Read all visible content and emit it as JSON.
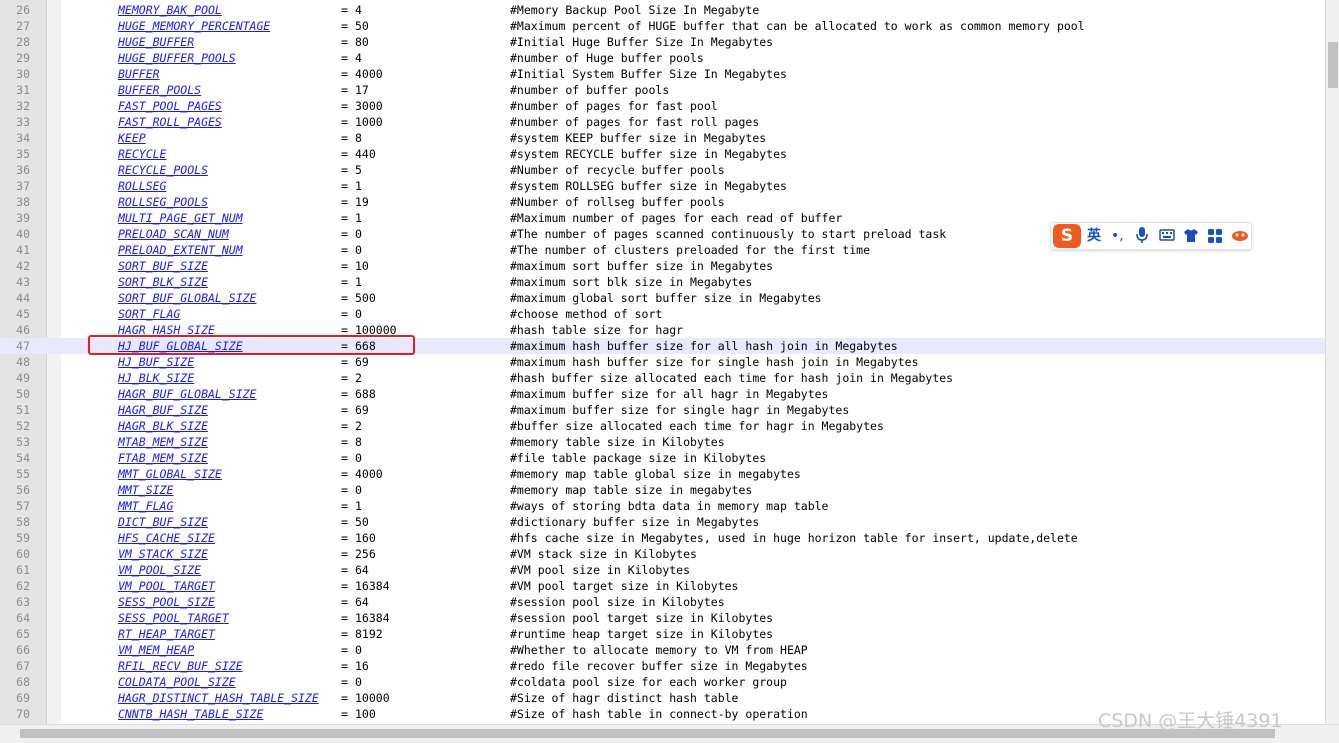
{
  "lines": [
    {
      "n": "26",
      "key": "MEMORY_BAK_POOL",
      "eq": "=",
      "val": "4",
      "cm": "#Memory Backup Pool Size In Megabyte"
    },
    {
      "n": "27",
      "key": "HUGE_MEMORY_PERCENTAGE",
      "eq": "=",
      "val": "50",
      "cm": "#Maximum percent of HUGE buffer that can be allocated to work as common memory pool"
    },
    {
      "n": "28",
      "key": "HUGE_BUFFER",
      "eq": "=",
      "val": "80",
      "cm": "#Initial Huge Buffer Size In Megabytes"
    },
    {
      "n": "29",
      "key": "HUGE_BUFFER_POOLS",
      "eq": "=",
      "val": "4",
      "cm": "#number of Huge buffer pools"
    },
    {
      "n": "30",
      "key": "BUFFER",
      "eq": "=",
      "val": "4000",
      "cm": "#Initial System Buffer Size In Megabytes"
    },
    {
      "n": "31",
      "key": "BUFFER_POOLS",
      "eq": "=",
      "val": "17",
      "cm": "#number of buffer pools"
    },
    {
      "n": "32",
      "key": "FAST_POOL_PAGES",
      "eq": "=",
      "val": "3000",
      "cm": "#number of pages for fast pool"
    },
    {
      "n": "33",
      "key": "FAST_ROLL_PAGES",
      "eq": "=",
      "val": "1000",
      "cm": "#number of pages for fast roll pages"
    },
    {
      "n": "34",
      "key": "KEEP",
      "eq": "=",
      "val": "8",
      "cm": "#system KEEP buffer size in Megabytes"
    },
    {
      "n": "35",
      "key": "RECYCLE",
      "eq": "=",
      "val": "440",
      "cm": "#system RECYCLE buffer size in Megabytes"
    },
    {
      "n": "36",
      "key": "RECYCLE_POOLS",
      "eq": "=",
      "val": "5",
      "cm": "#Number of recycle buffer pools"
    },
    {
      "n": "37",
      "key": "ROLLSEG",
      "eq": "=",
      "val": "1",
      "cm": "#system ROLLSEG buffer size in Megabytes"
    },
    {
      "n": "38",
      "key": "ROLLSEG_POOLS",
      "eq": "=",
      "val": "19",
      "cm": "#Number of rollseg buffer pools"
    },
    {
      "n": "39",
      "key": "MULTI_PAGE_GET_NUM",
      "eq": "=",
      "val": "1",
      "cm": "#Maximum number of pages for each read of buffer"
    },
    {
      "n": "40",
      "key": "PRELOAD_SCAN_NUM",
      "eq": "=",
      "val": "0",
      "cm": "#The number of pages scanned continuously to start preload task"
    },
    {
      "n": "41",
      "key": "PRELOAD_EXTENT_NUM",
      "eq": "=",
      "val": "0",
      "cm": "#The number of clusters preloaded for the first time"
    },
    {
      "n": "42",
      "key": "SORT_BUF_SIZE",
      "eq": "=",
      "val": "10",
      "cm": "#maximum sort buffer size in Megabytes"
    },
    {
      "n": "43",
      "key": "SORT_BLK_SIZE",
      "eq": "=",
      "val": "1",
      "cm": "#maximum sort blk size in Megabytes"
    },
    {
      "n": "44",
      "key": "SORT_BUF_GLOBAL_SIZE",
      "eq": "=",
      "val": "500",
      "cm": "#maximum global sort buffer size in Megabytes"
    },
    {
      "n": "45",
      "key": "SORT_FLAG",
      "eq": "=",
      "val": "0",
      "cm": "#choose method of sort"
    },
    {
      "n": "46",
      "key": "HAGR_HASH_SIZE",
      "eq": "=",
      "val": "100000",
      "cm": "#hash table size for hagr"
    },
    {
      "n": "47",
      "key": "HJ_BUF_GLOBAL_SIZE",
      "eq": "=",
      "val": "668",
      "cm": "#maximum hash buffer size for all hash join in Megabytes"
    },
    {
      "n": "48",
      "key": "HJ_BUF_SIZE",
      "eq": "=",
      "val": "69",
      "cm": "#maximum hash buffer size for single hash join in Megabytes"
    },
    {
      "n": "49",
      "key": "HJ_BLK_SIZE",
      "eq": "=",
      "val": "2",
      "cm": "#hash buffer size allocated each time for hash join in Megabytes"
    },
    {
      "n": "50",
      "key": "HAGR_BUF_GLOBAL_SIZE",
      "eq": "=",
      "val": "688",
      "cm": "#maximum buffer size for all hagr in Megabytes"
    },
    {
      "n": "51",
      "key": "HAGR_BUF_SIZE",
      "eq": "=",
      "val": "69",
      "cm": "#maximum buffer size for single hagr in Megabytes"
    },
    {
      "n": "52",
      "key": "HAGR_BLK_SIZE",
      "eq": "=",
      "val": "2",
      "cm": "#buffer size allocated each time for hagr in Megabytes"
    },
    {
      "n": "53",
      "key": "MTAB_MEM_SIZE",
      "eq": "=",
      "val": "8",
      "cm": "#memory table size in Kilobytes"
    },
    {
      "n": "54",
      "key": "FTAB_MEM_SIZE",
      "eq": "=",
      "val": "0",
      "cm": "#file table package size in Kilobytes"
    },
    {
      "n": "55",
      "key": "MMT_GLOBAL_SIZE",
      "eq": "=",
      "val": "4000",
      "cm": "#memory map table global size in megabytes"
    },
    {
      "n": "56",
      "key": "MMT_SIZE",
      "eq": "=",
      "val": "0",
      "cm": "#memory map table size in megabytes"
    },
    {
      "n": "57",
      "key": "MMT_FLAG",
      "eq": "=",
      "val": "1",
      "cm": "#ways of storing bdta data in memory map table"
    },
    {
      "n": "58",
      "key": "DICT_BUF_SIZE",
      "eq": "=",
      "val": "50",
      "cm": "#dictionary buffer size in Megabytes"
    },
    {
      "n": "59",
      "key": "HFS_CACHE_SIZE",
      "eq": "=",
      "val": "160",
      "cm": "#hfs cache size in Megabytes, used in huge horizon table for insert, update,delete"
    },
    {
      "n": "60",
      "key": "VM_STACK_SIZE",
      "eq": "=",
      "val": "256",
      "cm": "#VM stack size in Kilobytes"
    },
    {
      "n": "61",
      "key": "VM_POOL_SIZE",
      "eq": "=",
      "val": "64",
      "cm": "#VM pool size in Kilobytes"
    },
    {
      "n": "62",
      "key": "VM_POOL_TARGET",
      "eq": "=",
      "val": "16384",
      "cm": "#VM pool target size in Kilobytes"
    },
    {
      "n": "63",
      "key": "SESS_POOL_SIZE",
      "eq": "=",
      "val": "64",
      "cm": "#session pool size in Kilobytes"
    },
    {
      "n": "64",
      "key": "SESS_POOL_TARGET",
      "eq": "=",
      "val": "16384",
      "cm": "#session pool target size in Kilobytes"
    },
    {
      "n": "65",
      "key": "RT_HEAP_TARGET",
      "eq": "=",
      "val": "8192",
      "cm": "#runtime heap target size in Kilobytes"
    },
    {
      "n": "66",
      "key": "VM_MEM_HEAP",
      "eq": "=",
      "val": "0",
      "cm": "#Whether to allocate memory to VM from HEAP"
    },
    {
      "n": "67",
      "key": "RFIL_RECV_BUF_SIZE",
      "eq": "=",
      "val": "16",
      "cm": "#redo file recover buffer size in Megabytes"
    },
    {
      "n": "68",
      "key": "COLDATA_POOL_SIZE",
      "eq": "=",
      "val": "0",
      "cm": "#coldata pool size for each worker group"
    },
    {
      "n": "69",
      "key": "HAGR_DISTINCT_HASH_TABLE_SIZE",
      "eq": "=",
      "val": "10000",
      "cm": "#Size of hagr distinct hash table"
    },
    {
      "n": "70",
      "key": "CNNTB_HASH_TABLE_SIZE",
      "eq": "=",
      "val": "100",
      "cm": "#Size of hash table in connect-by operation"
    }
  ],
  "current_line": "47",
  "ime": {
    "logo": "S",
    "lang": "英",
    "punct": "•,",
    "icons": [
      "microphone-icon",
      "keyboard-icon",
      "skin-icon",
      "toolbox-icon",
      "more-icon"
    ]
  },
  "watermark": "CSDN @王大锤4391",
  "colors": {
    "key": "#1a1aff",
    "highlight_border": "#e02020",
    "current_line_bg": "#e8e8ff",
    "ime_logo": "#f05a22"
  }
}
